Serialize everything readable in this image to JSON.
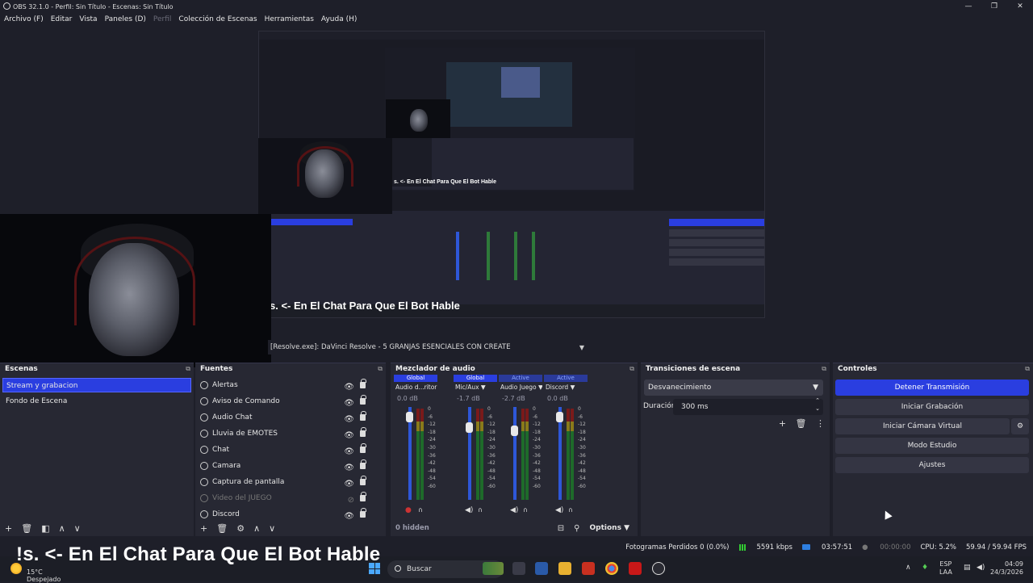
{
  "window": {
    "title": "OBS 32.1.0 - Perfil: Sin Título - Escenas: Sin Título",
    "controls": [
      "—",
      "❐",
      "✕"
    ]
  },
  "menu": [
    {
      "label": "Archivo (F)",
      "enabled": true
    },
    {
      "label": "Editar",
      "enabled": true
    },
    {
      "label": "Vista",
      "enabled": true
    },
    {
      "label": "Paneles (D)",
      "enabled": true
    },
    {
      "label": "Perfil",
      "enabled": false
    },
    {
      "label": "Colección de Escenas",
      "enabled": true
    },
    {
      "label": "Herramientas",
      "enabled": true
    },
    {
      "label": "Ayuda (H)",
      "enabled": true
    }
  ],
  "preview": {
    "ticker_text": "!s. <- En El Chat Para Que El Bot Hable",
    "nested_ticker": "s. <- En El Chat Para Que El Bot Hable",
    "nested_ticker_small": "s. <- En El Chat Para Que El Bot Hable"
  },
  "source_bar": {
    "text": "[Resolve.exe]: DaVinci Resolve - 5 GRANJAS ESENCIALES CON CREATE"
  },
  "scenes": {
    "title": "Escenas",
    "items": [
      {
        "label": "Stream  y grabacion",
        "selected": true
      },
      {
        "label": "Fondo de Escena",
        "selected": false
      }
    ]
  },
  "sources": {
    "title": "Fuentes",
    "items": [
      {
        "label": "Alertas",
        "icon": "globe-icon",
        "visible": true
      },
      {
        "label": "Aviso de Comando",
        "icon": "text-icon",
        "visible": true
      },
      {
        "label": "Audio Chat",
        "icon": "globe-icon",
        "visible": true
      },
      {
        "label": "Lluvia de EMOTES",
        "icon": "globe-icon",
        "visible": true
      },
      {
        "label": "Chat",
        "icon": "globe-icon",
        "visible": true
      },
      {
        "label": "Camara",
        "icon": "camera-icon",
        "visible": true
      },
      {
        "label": "Captura de pantalla",
        "icon": "monitor-icon",
        "visible": true
      },
      {
        "label": "Video del JUEGO",
        "icon": "game-icon",
        "visible": false
      },
      {
        "label": "Discord",
        "icon": "window-icon",
        "visible": true
      }
    ]
  },
  "mixer": {
    "title": "Mezclador de audio",
    "hidden_label": "0 hidden",
    "options_label": "Options",
    "ticks": [
      "0",
      "-6",
      "-12",
      "-18",
      "-24",
      "-30",
      "-36",
      "-42",
      "-48",
      "-54",
      "-60"
    ],
    "channels": [
      {
        "badge": "Global",
        "name": "Audio d...ritorio",
        "db": "0.0 dB",
        "volume": 0.9,
        "muted": true
      },
      {
        "badge": "Global",
        "name": "Mic/Aux",
        "db": "-1.7 dB",
        "volume": 0.78,
        "muted": false
      },
      {
        "badge": "Active",
        "name": "Audio Juego",
        "db": "-2.7 dB",
        "volume": 0.75,
        "muted": false
      },
      {
        "badge": "Active",
        "name": "Discord",
        "db": "0.0 dB",
        "volume": 0.9,
        "muted": false
      }
    ]
  },
  "transitions": {
    "title": "Transiciones de escena",
    "selected": "Desvanecimiento",
    "duration_label": "Duración",
    "duration_value": "300 ms"
  },
  "controls": {
    "title": "Controles",
    "buttons": [
      {
        "label": "Detener Transmisión",
        "primary": true
      },
      {
        "label": "Iniciar Grabación",
        "primary": false
      },
      {
        "label": "Iniciar Cámara Virtual",
        "primary": false
      },
      {
        "label": "Modo Estudio",
        "primary": false
      },
      {
        "label": "Ajustes",
        "primary": false
      }
    ]
  },
  "status": {
    "dropped": "Fotogramas Perdidos 0 (0.0%)",
    "bitrate": "5591 kbps",
    "stream_time": "03:57:51",
    "record_time": "00:00:00",
    "cpu": "CPU: 5.2%",
    "fps": "59.94 / 59.94 FPS"
  },
  "taskbar": {
    "weather_temp": "15°C",
    "weather_desc": "Despejado",
    "search_placeholder": "Buscar",
    "lang_top": "ESP",
    "lang_bottom": "LAA",
    "time": "04:09",
    "date": "24/3/2026"
  },
  "colors": {
    "accent": "#2a3ee0",
    "panel": "#272833",
    "bg": "#1e1f29"
  }
}
